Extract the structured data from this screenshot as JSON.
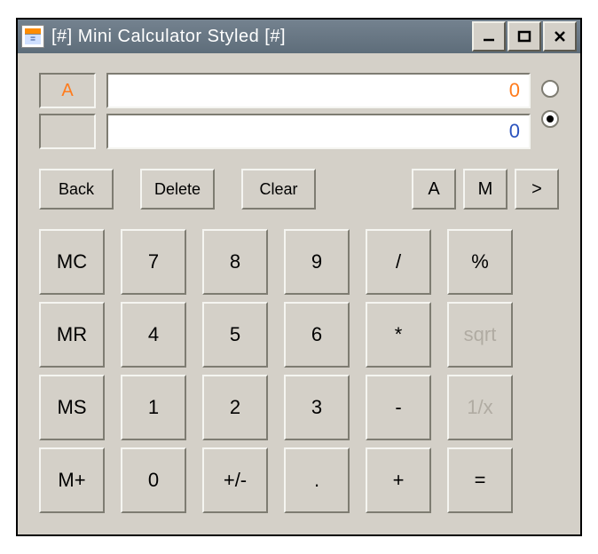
{
  "title": "[#] Mini Calculator Styled [#]",
  "appIconGlyph": "=",
  "displays": {
    "modeA": "A",
    "modeB": "",
    "valueA": "0",
    "valueB": "0"
  },
  "radios": {
    "selectedIndex": 1
  },
  "editRow": {
    "back": "Back",
    "delete": "Delete",
    "clear": "Clear",
    "aToggle": "A",
    "mToggle": "M",
    "more": ">"
  },
  "keypad": [
    [
      "MC",
      "7",
      "8",
      "9",
      "/",
      "%"
    ],
    [
      "MR",
      "4",
      "5",
      "6",
      "*",
      "sqrt"
    ],
    [
      "MS",
      "1",
      "2",
      "3",
      "-",
      "1/x"
    ],
    [
      "M+",
      "0",
      "+/-",
      ".",
      "+",
      "="
    ]
  ],
  "lightKeys": [
    "sqrt",
    "1/x"
  ]
}
